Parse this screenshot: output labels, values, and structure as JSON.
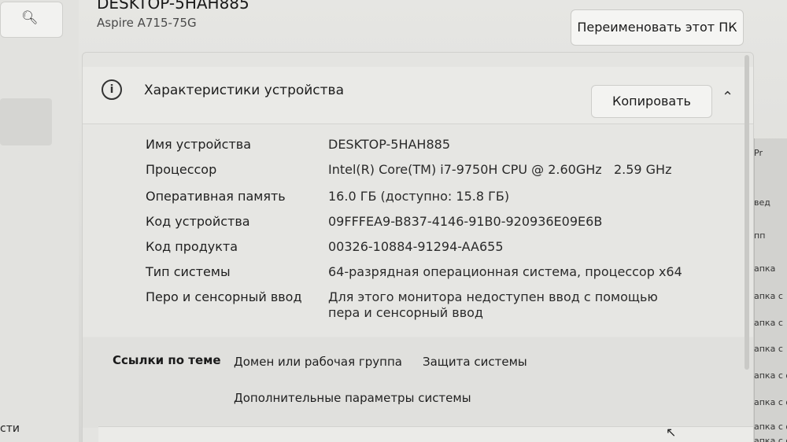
{
  "left_nav": {
    "search_icon": "search-icon",
    "partial_labels": [
      "сти"
    ]
  },
  "header": {
    "device_name": "DESKTOP-5HAH885",
    "device_model": "Aspire A715-75G",
    "rename_button": "Переименовать этот ПК"
  },
  "device_specs": {
    "title": "Характеристики устройства",
    "copy_button": "Копировать",
    "rows": [
      {
        "label": "Имя устройства",
        "value": "DESKTOP-5HAH885"
      },
      {
        "label": "Процессор",
        "value": "Intel(R) Core(TM) i7-9750H CPU @ 2.60GHz   2.59 GHz"
      },
      {
        "label": "Оперативная память",
        "value": "16.0 ГБ (доступно: 15.8 ГБ)"
      },
      {
        "label": "Код устройства",
        "value": "09FFFEA9-B837-4146-91B0-920936E09E6B"
      },
      {
        "label": "Код продукта",
        "value": "00326-10884-91294-AA655"
      },
      {
        "label": "Тип системы",
        "value": "64-разрядная операционная система, процессор x64"
      },
      {
        "label": "Перо и сенсорный ввод",
        "value": "Для этого монитора недоступен ввод с помощью пера и сенсорный ввод"
      }
    ]
  },
  "related_links": {
    "label": "Ссылки по теме",
    "links": [
      "Домен или рабочая группа",
      "Защита системы",
      "Дополнительные параметры системы"
    ]
  },
  "background_window": {
    "texts": [
      "Pr",
      "вед",
      "пп",
      "апка",
      "апка с",
      "апка с",
      "апка с",
      "апка с ф",
      "апка с ф",
      "апка с ф",
      "апка с ф"
    ]
  }
}
